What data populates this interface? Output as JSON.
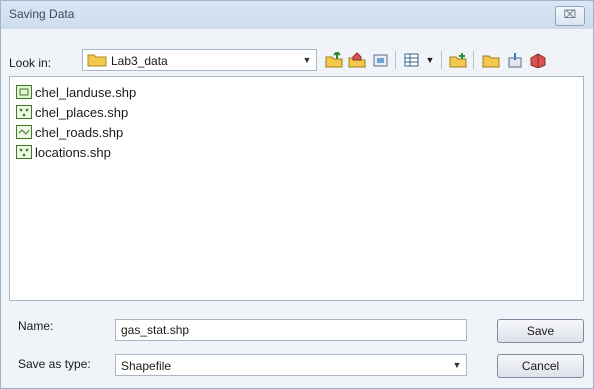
{
  "window": {
    "title": "Saving Data",
    "close_glyph": "⌧"
  },
  "lookin": {
    "label": "Look in:",
    "value": "Lab3_data"
  },
  "toolbar": {
    "icons": [
      "up-folder-icon",
      "home-folder-icon",
      "catalog-icon",
      "view-menu-icon",
      "new-folder-icon",
      "folder-icon",
      "connect-icon",
      "disconnect-icon"
    ]
  },
  "files": [
    {
      "name": "chel_landuse.shp",
      "icon": "polygon-shapefile-icon"
    },
    {
      "name": "chel_places.shp",
      "icon": "point-shapefile-icon"
    },
    {
      "name": "chel_roads.shp",
      "icon": "line-shapefile-icon"
    },
    {
      "name": "locations.shp",
      "icon": "point-shapefile-icon"
    }
  ],
  "form": {
    "name_label": "Name:",
    "name_value": "gas_stat.shp",
    "type_label": "Save as type:",
    "type_value": "Shapefile"
  },
  "buttons": {
    "save": "Save",
    "cancel": "Cancel"
  },
  "colors": {
    "accent": "#cddcee",
    "folder": "#f2c94c"
  }
}
